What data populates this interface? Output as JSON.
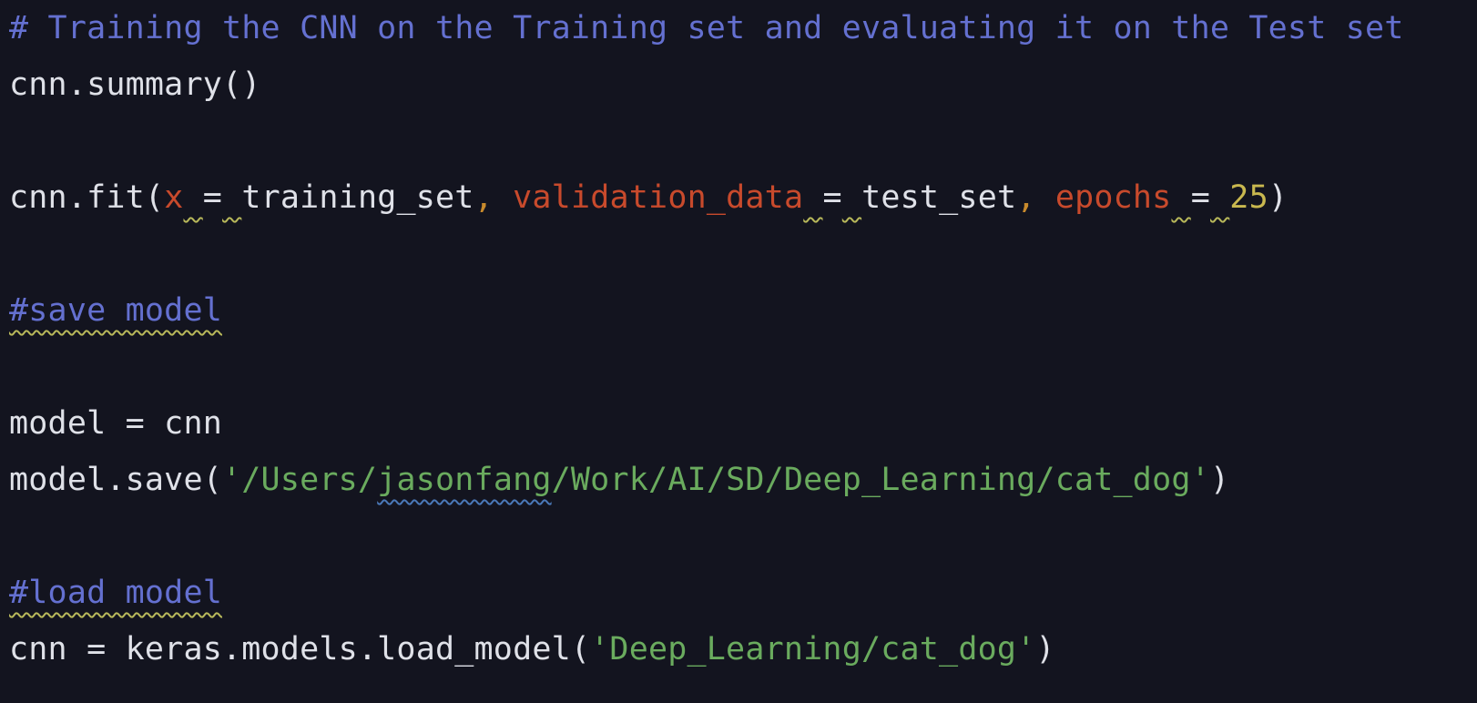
{
  "editor": {
    "background": "#13141f",
    "colors": {
      "comment": "#6470d0",
      "plain": "#dfe1e8",
      "param": "#c84a2c",
      "number": "#c9b84f",
      "string": "#6aab5e",
      "warning_squiggle": "#b8b85a",
      "typo_squiggle": "#4a78b8"
    },
    "lines": {
      "l1": {
        "comment": "# Training the CNN on the Training set and evaluating it on the Test set"
      },
      "l2": {
        "text": "cnn.summary()"
      },
      "l4": {
        "call": "cnn.fit(",
        "arg1_name": "x",
        "arg1_eq": "=",
        "arg1_val": "training_set",
        "comma1": ",",
        "arg2_name": "validation_data",
        "arg2_eq": "=",
        "arg2_val": "test_set",
        "comma2": ",",
        "arg3_name": "epochs",
        "arg3_eq": "=",
        "arg3_val": "25",
        "close": ")"
      },
      "l6": {
        "comment": "#save model"
      },
      "l8": {
        "text": "model = cnn"
      },
      "l9": {
        "call": "model.save(",
        "str_prefix": "'/Users/",
        "str_typo": "jasonfang",
        "str_suffix": "/Work/AI/SD/Deep_Learning/cat_dog'",
        "close": ")"
      },
      "l11": {
        "comment": "#load model"
      },
      "l12": {
        "call": "cnn = keras.models.load_model(",
        "str": "'Deep_Learning/cat_dog'",
        "close": ")"
      }
    }
  }
}
